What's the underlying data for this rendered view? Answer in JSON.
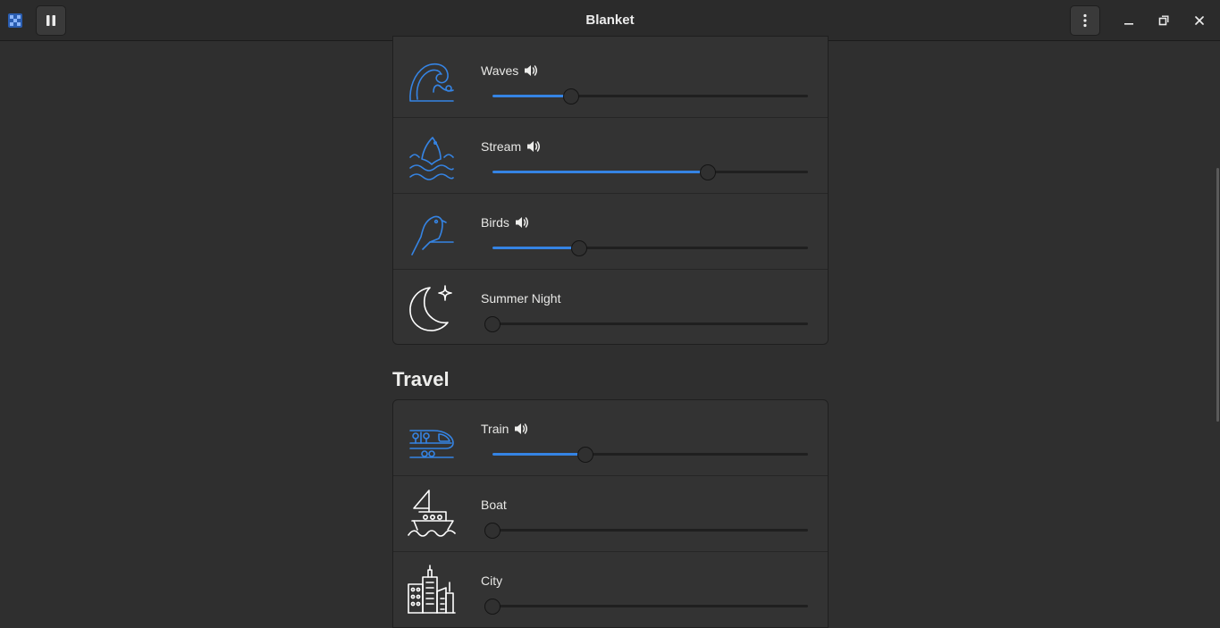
{
  "window": {
    "title": "Blanket",
    "app_icon": "blanket-app-icon",
    "controls": {
      "play_pause_icon": "pause-icon",
      "menu_icon": "kebab-menu-icon",
      "minimize_icon": "minimize-icon",
      "maximize_icon": "maximize-icon",
      "close_icon": "close-icon"
    }
  },
  "colors": {
    "accent": "#3584e4",
    "background": "#2f2f2f",
    "card": "#333333",
    "icon_active": "#3584e4",
    "icon_inactive": "#ffffff"
  },
  "nature_sounds": [
    {
      "name": "Waves",
      "icon": "waves-icon",
      "playing": true,
      "volume": 0.25
    },
    {
      "name": "Stream",
      "icon": "stream-icon",
      "playing": true,
      "volume": 0.68
    },
    {
      "name": "Birds",
      "icon": "birds-icon",
      "playing": true,
      "volume": 0.28
    },
    {
      "name": "Summer Night",
      "icon": "summer-night-icon",
      "playing": false,
      "volume": 0
    }
  ],
  "travel": {
    "title": "Travel",
    "sounds": [
      {
        "name": "Train",
        "icon": "train-icon",
        "playing": true,
        "volume": 0.295
      },
      {
        "name": "Boat",
        "icon": "boat-icon",
        "playing": false,
        "volume": 0
      },
      {
        "name": "City",
        "icon": "city-icon",
        "playing": false,
        "volume": 0
      }
    ]
  }
}
